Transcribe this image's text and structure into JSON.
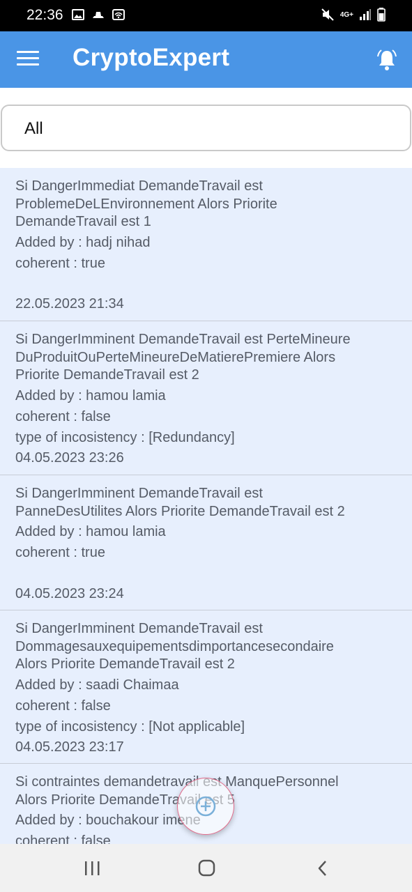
{
  "status_bar": {
    "time": "22:36",
    "left_icons": [
      "image-icon",
      "hat-icon",
      "wifi-icon"
    ],
    "right_icons": [
      "mute-icon",
      "4g-icon",
      "signal-icon",
      "battery-icon"
    ],
    "network_label": "4G+"
  },
  "app_bar": {
    "title": "CryptoExpert",
    "menu_icon": "menu-icon",
    "bell_icon": "notification-bell-icon",
    "color": "#4a95e6"
  },
  "filter": {
    "value": "All"
  },
  "rules": [
    {
      "lines": [
        "Si DangerImmediat DemandeTravail est",
        "ProblemeDeLEnvironnement Alors Priorite",
        "DemandeTravail est 1",
        "Added by : hadj nihad",
        "coherent : true"
      ],
      "date": "22.05.2023 21:34"
    },
    {
      "lines": [
        "Si DangerImminent DemandeTravail est PerteMineure",
        "DuProduitOuPerteMineureDeMatierePremiere Alors",
        "Priorite DemandeTravail est 2",
        "Added by : hamou lamia",
        "coherent : false",
        "type of incosistency : [Redundancy]"
      ],
      "date": "04.05.2023 23:26"
    },
    {
      "lines": [
        "Si DangerImminent DemandeTravail est",
        "PanneDesUtilites Alors Priorite DemandeTravail est 2",
        "Added by : hamou lamia",
        "coherent : true"
      ],
      "date": "04.05.2023 23:24"
    },
    {
      "lines": [
        "Si DangerImminent DemandeTravail est",
        "Dommagesauxequipementsdimportancesecondaire",
        "Alors Priorite DemandeTravail est 2",
        "Added by : saadi Chaimaa",
        "coherent : false",
        "type of incosistency : [Not applicable]"
      ],
      "date": "04.05.2023 23:17"
    },
    {
      "lines": [
        "Si contraintes demandetravail est ManquePersonnel",
        "Alors Priorite DemandeTravail est 5",
        "Added by : bouchakour imene",
        "coherent : false"
      ],
      "date": ""
    }
  ],
  "fab": {
    "icon": "add-circle-icon"
  },
  "nav_bar": {
    "icons": [
      "recent-apps-icon",
      "home-icon",
      "back-icon"
    ]
  }
}
